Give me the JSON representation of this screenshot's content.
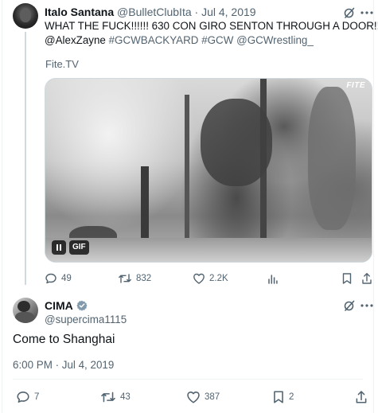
{
  "reply_tweet": {
    "display_name": "Italo Santana",
    "handle": "@BulletClubIta",
    "separator": "·",
    "date": "Jul 4, 2019",
    "text_line1": "WHAT THE FUCK!!!!!! 630 CON GIRO SENTON THROUGH A DOOR!!!!",
    "mention": "@AlexZayne",
    "hashtag1": "#GCWBACKYARD",
    "hashtag2": "#GCW",
    "mention2": "@GCWrestling_",
    "source": "Fite.TV",
    "media": {
      "badge": "FITE",
      "gif_label": "GIF"
    },
    "actions": {
      "replies": "49",
      "reposts": "832",
      "likes": "2.2K"
    }
  },
  "main_tweet": {
    "display_name": "CIMA",
    "handle": "@supercima1115",
    "text": "Come to Shanghai",
    "timestamp": "6:00 PM · Jul 4, 2019",
    "actions": {
      "replies": "7",
      "reposts": "43",
      "likes": "387",
      "bookmarks": "2"
    }
  },
  "colors": {
    "text": "#0f1419",
    "muted": "#536471",
    "link": "#1d9bf0",
    "border": "#eff3f4"
  },
  "icons": [
    "grok-icon",
    "more-icon",
    "reply-icon",
    "repost-icon",
    "like-icon",
    "views-icon",
    "bookmark-icon",
    "share-icon",
    "verified-icon",
    "pause-icon"
  ]
}
